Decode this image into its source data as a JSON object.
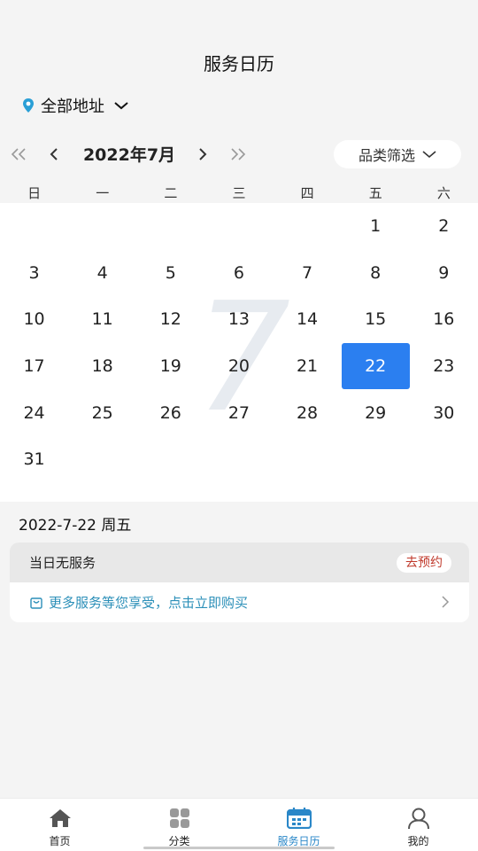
{
  "header": {
    "title": "服务日历"
  },
  "address": {
    "label": "全部地址"
  },
  "month_bar": {
    "prev_year": "«",
    "prev_month": "‹",
    "month_label": "2022年7月",
    "next_month": "›",
    "next_year": "»",
    "filter_label": "品类筛选"
  },
  "weekdays": [
    "日",
    "一",
    "二",
    "三",
    "四",
    "五",
    "六"
  ],
  "calendar": {
    "watermark": "7",
    "leading_blanks": 5,
    "days": [
      "1",
      "2",
      "3",
      "4",
      "5",
      "6",
      "7",
      "8",
      "9",
      "10",
      "11",
      "12",
      "13",
      "14",
      "15",
      "16",
      "17",
      "18",
      "19",
      "20",
      "21",
      "22",
      "23",
      "24",
      "25",
      "26",
      "27",
      "28",
      "29",
      "30",
      "31"
    ],
    "selected_day": "22"
  },
  "selected_date": {
    "label": "2022-7-22 周五"
  },
  "service_card": {
    "no_service": "当日无服务",
    "book_button": "去预约",
    "promo_text": "更多服务等您享受，点击立即购买"
  },
  "tabbar": {
    "tabs": [
      {
        "label": "首页",
        "icon": "home-icon",
        "active": false
      },
      {
        "label": "分类",
        "icon": "grid-icon",
        "active": false
      },
      {
        "label": "服务日历",
        "icon": "calendar-icon",
        "active": true
      },
      {
        "label": "我的",
        "icon": "user-icon",
        "active": false
      }
    ]
  },
  "colors": {
    "accent": "#2b7ff0",
    "tab_active": "#2a87c8",
    "book_text": "#c0392b",
    "promo_text": "#2b8fb8"
  }
}
